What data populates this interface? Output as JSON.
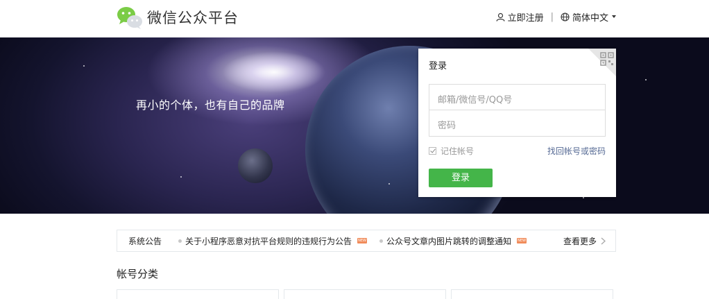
{
  "header": {
    "title": "微信公众平台",
    "register_label": "立即注册",
    "separator": "|",
    "language_label": "简体中文",
    "icons": [
      "wechat-logo-icon",
      "user-icon",
      "globe-icon",
      "caret-down-icon"
    ]
  },
  "banner": {
    "slogan": "再小的个体，也有自己的品牌"
  },
  "login": {
    "title": "登录",
    "account_placeholder": "邮箱/微信号/QQ号",
    "password_placeholder": "密码",
    "remember_label": "记住帐号",
    "remember_checked": true,
    "forgot_label": "找回帐号或密码",
    "submit_label": "登录",
    "qr_icon": "qrcode-icon"
  },
  "notice": {
    "label": "系统公告",
    "items": [
      {
        "text": "关于小程序恶意对抗平台规则的违规行为公告",
        "badge": "NEW"
      },
      {
        "text": "公众号文章内图片跳转的调整通知",
        "badge": "NEW"
      }
    ],
    "more_label": "查看更多"
  },
  "categories": {
    "title": "帐号分类"
  },
  "colors": {
    "brand_green": "#44b549",
    "link_blue": "#576b95",
    "badge_orange": "#f18c5b"
  }
}
